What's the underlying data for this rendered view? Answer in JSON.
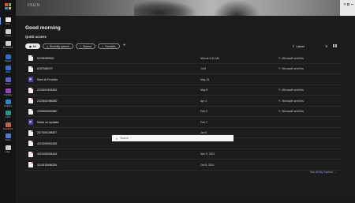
{
  "rail": {
    "items": [
      {
        "label": "Home",
        "icon": "home-icon",
        "color": "#e6e6e6"
      },
      {
        "label": "Create",
        "icon": "create-icon",
        "color": "#cfcfcf"
      },
      {
        "label": "My Content",
        "icon": "folder-icon",
        "color": "#cfcfcf"
      },
      {
        "label": "Outlook",
        "icon": "outlook-icon",
        "color": "#1e74d6"
      },
      {
        "label": "Word",
        "icon": "word-icon",
        "color": "#2b6fe0"
      },
      {
        "label": "Teams",
        "icon": "teams-icon",
        "color": "#5b5fd6"
      },
      {
        "label": "OneNote",
        "icon": "onenote-icon",
        "color": "#9a3fd1"
      },
      {
        "label": "OneDrive",
        "icon": "onedrive-icon",
        "color": "#1f8ae0"
      },
      {
        "label": "Forms",
        "icon": "forms-icon",
        "color": "#1e9e8e"
      },
      {
        "label": "PowerPoint",
        "icon": "powerpoint-icon",
        "color": "#d65a33"
      },
      {
        "label": "Admin",
        "icon": "admin-icon",
        "color": "#4a7be0"
      },
      {
        "label": "Apps",
        "icon": "apps-icon",
        "color": "#cfcfcf"
      }
    ]
  },
  "banner": {
    "tag": "ISDS"
  },
  "main": {
    "greeting": "Good morning",
    "quick_access": "Quick access",
    "chips": [
      {
        "label": "All",
        "icon": "grid-icon",
        "selected": true
      },
      {
        "label": "Recently opened",
        "icon": "clock-icon",
        "selected": false
      },
      {
        "label": "Shared",
        "icon": "people-icon",
        "selected": false
      },
      {
        "label": "Favorites",
        "icon": "star-icon",
        "selected": false
      }
    ],
    "upload_label": "Upload",
    "files": [
      {
        "name": "51256289520",
        "type": "pdf",
        "date": "Mon at 4:41 AM",
        "activity": "Microsoft sent this"
      },
      {
        "name": "6157088379",
        "type": "pdf",
        "date": "Jul 8",
        "activity": "Microsoft sent this"
      },
      {
        "name": "Semi AI Provider",
        "type": "form",
        "date": "May 15",
        "activity": ""
      },
      {
        "name": "2234919494826",
        "type": "pdf",
        "date": "May 8",
        "activity": "Microsoft sent this"
      },
      {
        "name": "2223841966080",
        "type": "pdf",
        "date": "Apr 4",
        "activity": "Microsoft sent this"
      },
      {
        "name": "2209952692880",
        "type": "pdf",
        "date": "Feb 9",
        "activity": "Microsoft sent this"
      },
      {
        "name": "Notes on updates",
        "type": "form",
        "date": "Feb 2",
        "activity": ""
      },
      {
        "name": "2371651088827",
        "type": "pdf",
        "date": "Jan 5",
        "activity": ""
      },
      {
        "name": "4210093051636",
        "type": "pdf",
        "date": "",
        "activity": ""
      },
      {
        "name": "4210453094446",
        "type": "pdf",
        "date": "Nov 9, 2021",
        "activity": ""
      },
      {
        "name": "4210153696254",
        "type": "pdf",
        "date": "Oct 8, 2021",
        "activity": ""
      }
    ],
    "see_all": "See All My Content"
  },
  "search": {
    "placeholder": "Search"
  }
}
